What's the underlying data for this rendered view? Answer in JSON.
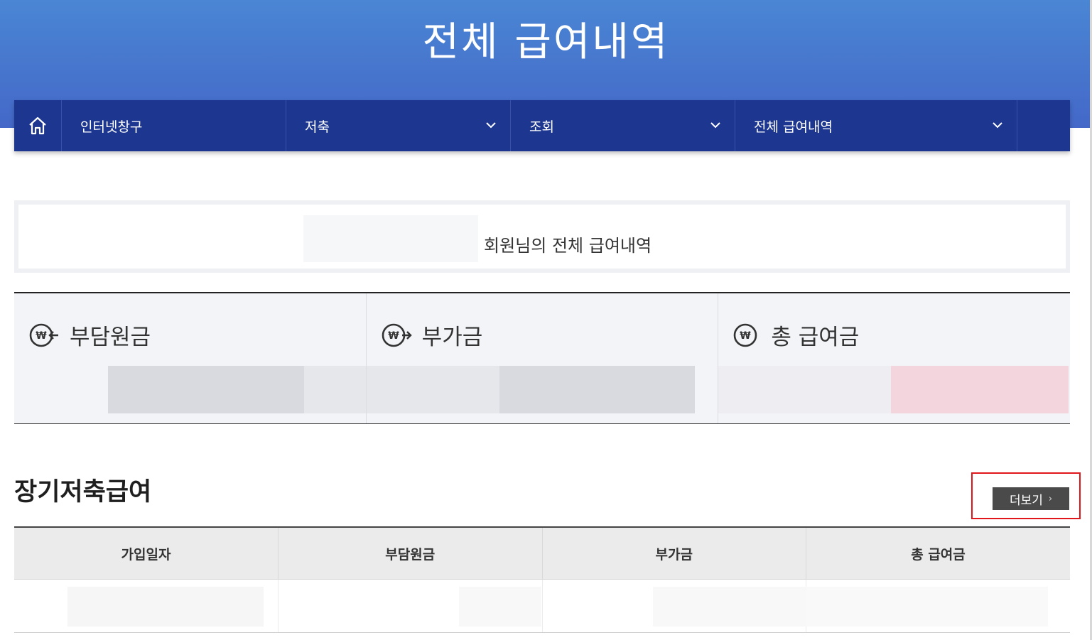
{
  "page": {
    "title": "전체 급여내역"
  },
  "breadcrumb": {
    "home_icon": "home-icon",
    "items": [
      {
        "label": "인터넷창구",
        "has_dropdown": false
      },
      {
        "label": "저축",
        "has_dropdown": true
      },
      {
        "label": "조회",
        "has_dropdown": true
      },
      {
        "label": "전체 급여내역",
        "has_dropdown": true
      }
    ]
  },
  "member": {
    "text": "회원님의 전체 급여내역"
  },
  "summary": {
    "cards": [
      {
        "label": "부담원금",
        "icon": "won-in-icon"
      },
      {
        "label": "부가금",
        "icon": "won-out-icon"
      },
      {
        "label": "총 급여금",
        "icon": "won-icon"
      }
    ]
  },
  "section": {
    "title": "장기저축급여",
    "more_label": "더보기",
    "more_arrow": "›"
  },
  "table": {
    "headers": [
      "가입일자",
      "부담원금",
      "부가금",
      "총 급여금"
    ]
  },
  "colors": {
    "header_gradient_top": "#4a86d4",
    "header_gradient_bottom": "#4468c8",
    "nav_bg": "#1d3791",
    "highlight_border": "#e0161a",
    "more_button_bg": "#4a4a4a"
  }
}
